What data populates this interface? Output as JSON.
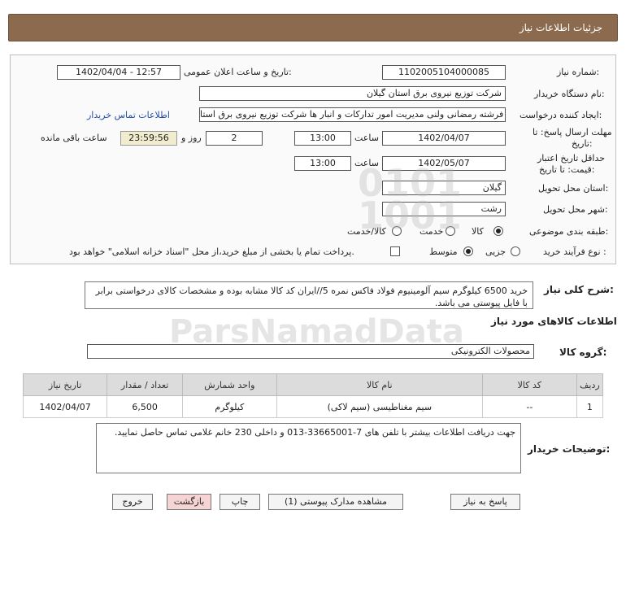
{
  "header": {
    "title": "جزئیات اطلاعات نیاز"
  },
  "form": {
    "need_number_label": "شماره نیاز:",
    "need_number": "1102005104000085",
    "announce_label": "تاریخ و ساعت اعلان عمومی:",
    "announce_value": "1402/04/04 - 12:57",
    "buyer_org_label": "نام دستگاه خریدار:",
    "buyer_org": "شرکت توزیع نیروی برق استان گیلان",
    "creator_label": "ایجاد کننده درخواست:",
    "creator": "فرشته رمضانی ولنی مدیریت امور تدارکات و انبار ها شرکت توزیع نیروی برق استا",
    "contact_link": "اطلاعات تماس خریدار",
    "deadline_label_1": "مهلت ارسال پاسخ: تا",
    "deadline_label_2": "تاریخ:",
    "deadline_date": "1402/05/07",
    "deadline_date_visible": "1402/04/07",
    "time_label": "ساعت",
    "deadline_time": "13:00",
    "days_count": "2",
    "day_and_label": "روز و",
    "remaining_time": "23:59:56",
    "remaining_label": "ساعت باقی مانده",
    "validity_label_1": "حداقل تاریخ اعتبار",
    "validity_label_2": "قیمت: تا تاریخ:",
    "validity_date": "1402/05/07",
    "validity_time": "13:00",
    "province_label": "استان محل تحویل:",
    "province": "گیلان",
    "city_label": "شهر محل تحویل:",
    "city": "رشت",
    "category_label": "طبقه بندی موضوعی:",
    "category_options": [
      "کالا",
      "خدمت",
      "کالا/خدمت"
    ],
    "process_label": "نوع فرآیند خرید :",
    "process_options": [
      "جزیی",
      "متوسط"
    ],
    "payment_note": "پرداخت تمام یا بخشی از مبلغ خرید،از محل \"اسناد خزانه اسلامی\" خواهد بود."
  },
  "summary": {
    "label": "شرح کلی نیاز:",
    "text": "خرید 6500 کیلوگرم سیم آلومینیوم فولاد فاکس نمره 5//ایران کد کالا مشابه بوده و مشخصات کالای درخواستی برابر با فایل پیوستی می باشد."
  },
  "goods": {
    "section_title": "اطلاعات کالاهای مورد نیاز",
    "group_label": "گروه کالا:",
    "group_value": "محصولات الکترونیکی",
    "columns": [
      "ردیف",
      "کد کالا",
      "نام کالا",
      "واحد شمارش",
      "تعداد / مقدار",
      "تاریخ نیاز"
    ],
    "rows": [
      [
        "1",
        "--",
        "سیم مغناطیسی (سیم لاکی)",
        "کیلوگرم",
        "6,500",
        "1402/04/07"
      ]
    ]
  },
  "buyer_notes": {
    "label": "توضیحات خریدار:",
    "text": "جهت دریافت اطلاعات بیشتر با تلفن های 7-33665001-013 و داخلی 230 خانم غلامی تماس حاصل نمایید."
  },
  "buttons": {
    "reply": "پاسخ به نیاز",
    "attachments": "مشاهده مدارک پیوستی (1)",
    "print": "چاپ",
    "back": "بازگشت",
    "exit": "خروج"
  },
  "watermark": {
    "text": "ParsNamadData"
  },
  "colors": {
    "header_bg": "#8b6a4d",
    "link": "#1f4fa6",
    "remaining_bg": "#f0eccd",
    "back_btn": "#f7d4d4"
  }
}
